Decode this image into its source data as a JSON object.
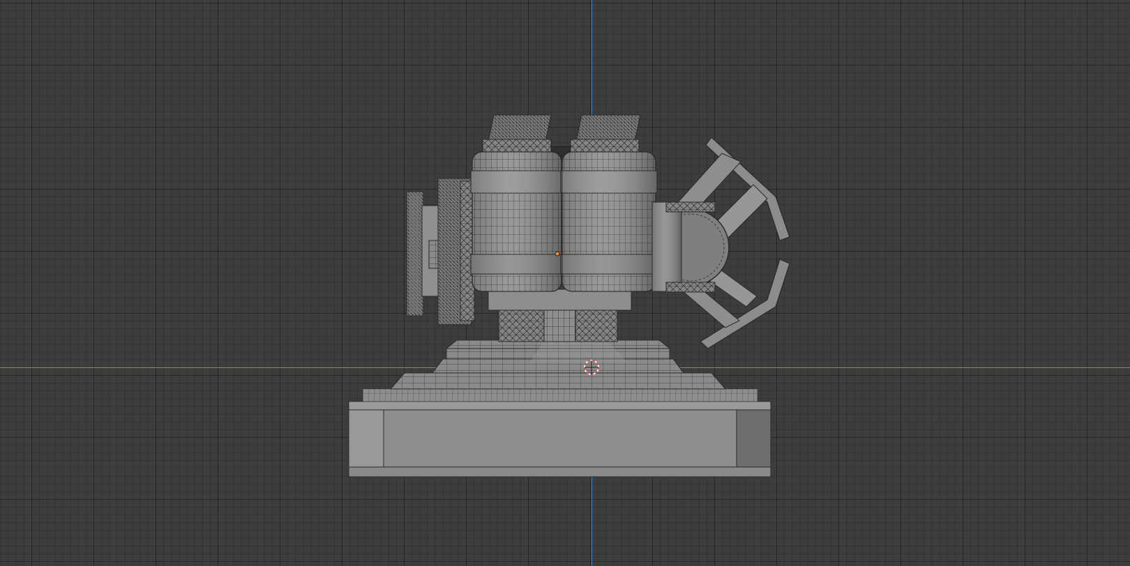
{
  "viewport": {
    "view": "3D Viewport",
    "background": "#3d3d3d",
    "grid_color": "#2f2f2f",
    "axis_z_color": "#4a78b8",
    "axis_y_color": "#7a9a3c",
    "mesh_fill": "#8c8c8c",
    "wire_color": "#2a2a2a",
    "cursor_color": "#e04a3c",
    "origin_color": "#f08a30"
  },
  "model": {
    "name": "turret",
    "parts": [
      "base",
      "pedestal",
      "twin-tanks",
      "side-wheel",
      "radar-dish"
    ]
  }
}
